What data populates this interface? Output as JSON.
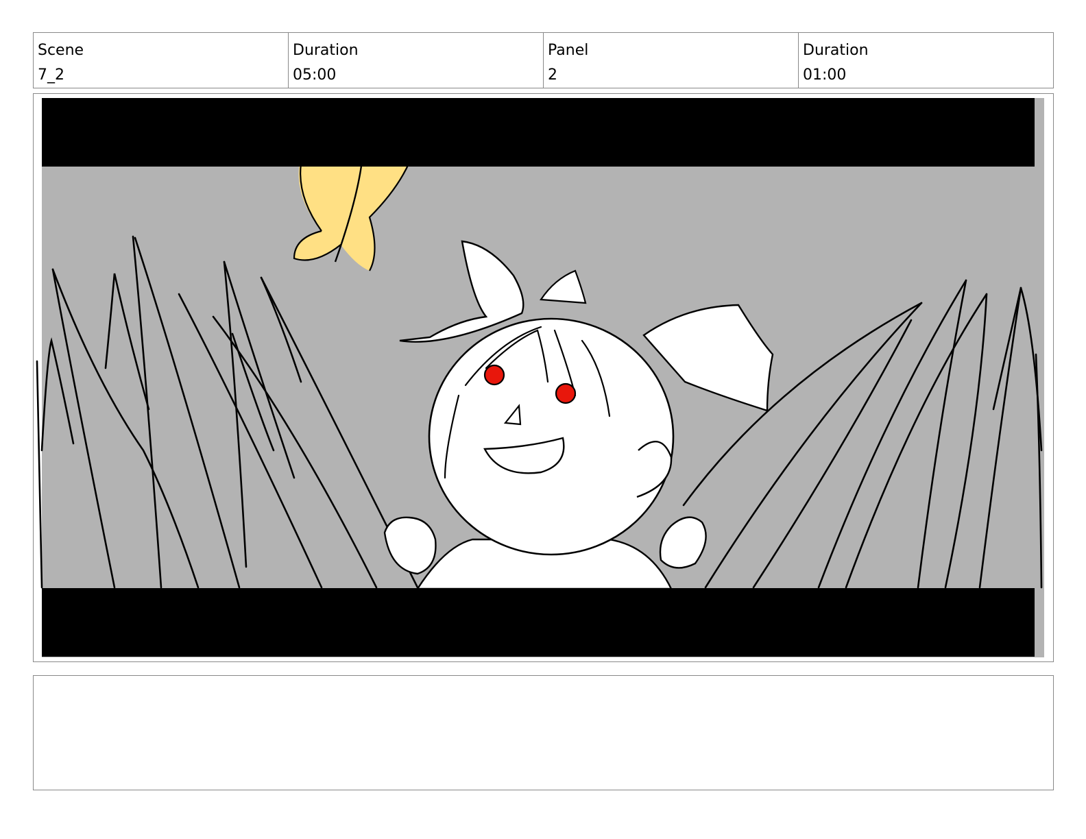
{
  "header": {
    "scene_label": "Scene",
    "scene_value": "7_2",
    "scene_duration_label": "Duration",
    "scene_duration_value": "05:00",
    "panel_label": "Panel",
    "panel_value": "2",
    "panel_duration_label": "Duration",
    "panel_duration_value": "01:00"
  },
  "panel_image": {
    "letterbox_color": "#000000",
    "background_color": "#b3b3b3",
    "butterfly_color": "#ffe084",
    "eye_color": "#e8170c"
  },
  "notes": {
    "text": ""
  }
}
